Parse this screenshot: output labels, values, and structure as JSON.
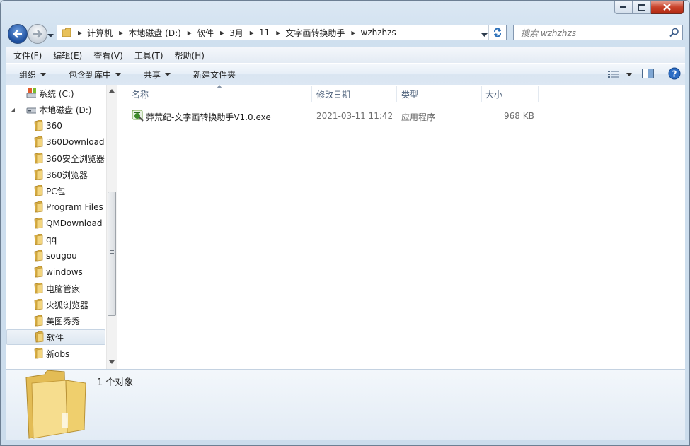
{
  "window": {
    "minimize": "–",
    "maximize": "□",
    "close": "✕"
  },
  "address": {
    "segments": [
      "计算机",
      "本地磁盘 (D:)",
      "软件",
      "3月",
      "11",
      "文字画转换助手",
      "wzhzhzs"
    ]
  },
  "search": {
    "placeholder": "搜索 wzhzhzs"
  },
  "menu": [
    "文件(F)",
    "编辑(E)",
    "查看(V)",
    "工具(T)",
    "帮助(H)"
  ],
  "toolbar": {
    "organize": "组织",
    "include_library": "包含到库中",
    "share": "共享",
    "new_folder": "新建文件夹"
  },
  "tree": [
    {
      "label": "系统 (C:)",
      "icon": "system-drive-icon"
    },
    {
      "label": "本地磁盘 (D:)",
      "icon": "drive-icon"
    },
    {
      "label": "360",
      "icon": "folder-icon"
    },
    {
      "label": "360Download",
      "icon": "folder-icon"
    },
    {
      "label": "360安全浏览器",
      "icon": "folder-icon"
    },
    {
      "label": "360浏览器",
      "icon": "folder-icon"
    },
    {
      "label": "PC包",
      "icon": "folder-icon"
    },
    {
      "label": "Program Files",
      "icon": "folder-icon"
    },
    {
      "label": "QMDownload",
      "icon": "folder-icon"
    },
    {
      "label": "qq",
      "icon": "folder-icon"
    },
    {
      "label": "sougou",
      "icon": "folder-icon"
    },
    {
      "label": "windows",
      "icon": "folder-icon"
    },
    {
      "label": "电脑管家",
      "icon": "folder-icon"
    },
    {
      "label": "火狐浏览器",
      "icon": "folder-icon"
    },
    {
      "label": "美图秀秀",
      "icon": "folder-icon"
    },
    {
      "label": "软件",
      "icon": "folder-icon",
      "selected": true
    },
    {
      "label": "新obs",
      "icon": "folder-icon"
    }
  ],
  "columns": [
    "名称",
    "修改日期",
    "类型",
    "大小"
  ],
  "files": [
    {
      "name": "莽荒纪-文字画转换助手V1.0.exe",
      "modified": "2021-03-11 11:42",
      "type": "应用程序",
      "size": "968 KB"
    }
  ],
  "status": {
    "count": "1 个对象"
  },
  "colors": {
    "selection": "#dde7f1",
    "header_text": "#4c607a",
    "frame": "#cfdde9"
  }
}
